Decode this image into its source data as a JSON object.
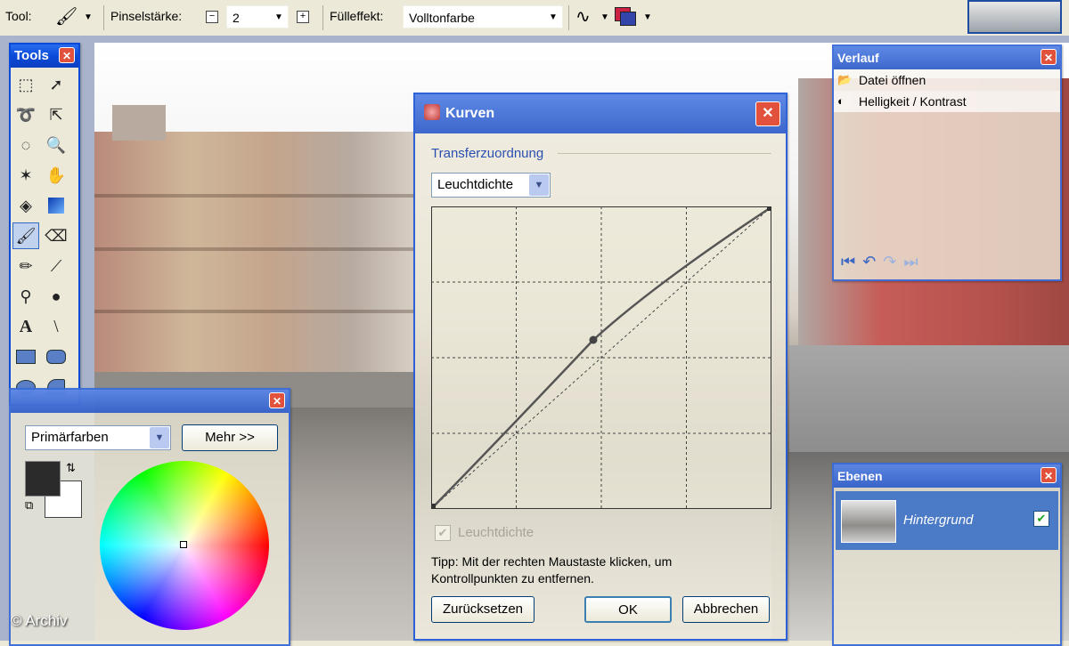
{
  "toolbar": {
    "tool_label": "Tool:",
    "brush_size_label": "Pinselstärke:",
    "brush_size_value": "2",
    "fill_label": "Fülleffekt:",
    "fill_value": "Volltonfarbe"
  },
  "tools_window": {
    "title": "Tools"
  },
  "colors_window": {
    "mode_value": "Primärfarben",
    "more_button": "Mehr >>"
  },
  "curves_dialog": {
    "title": "Kurven",
    "group_label": "Transferzuordnung",
    "mode_value": "Leuchtdichte",
    "checkbox_label": "Leuchtdichte",
    "tip_line1": "Tipp: Mit der rechten Maustaste klicken, um",
    "tip_line2": "Kontrollpunkten zu entfernen.",
    "reset_button": "Zurücksetzen",
    "ok_button": "OK",
    "cancel_button": "Abbrechen"
  },
  "history_window": {
    "title": "Verlauf",
    "items": [
      {
        "label": "Datei öffnen",
        "icon": "folder-icon"
      },
      {
        "label": "Helligkeit / Kontrast",
        "icon": "brightness-icon"
      }
    ]
  },
  "layers_window": {
    "title": "Ebenen",
    "layers": [
      {
        "name": "Hintergrund",
        "visible": true
      }
    ]
  },
  "watermark": "© Archiv"
}
